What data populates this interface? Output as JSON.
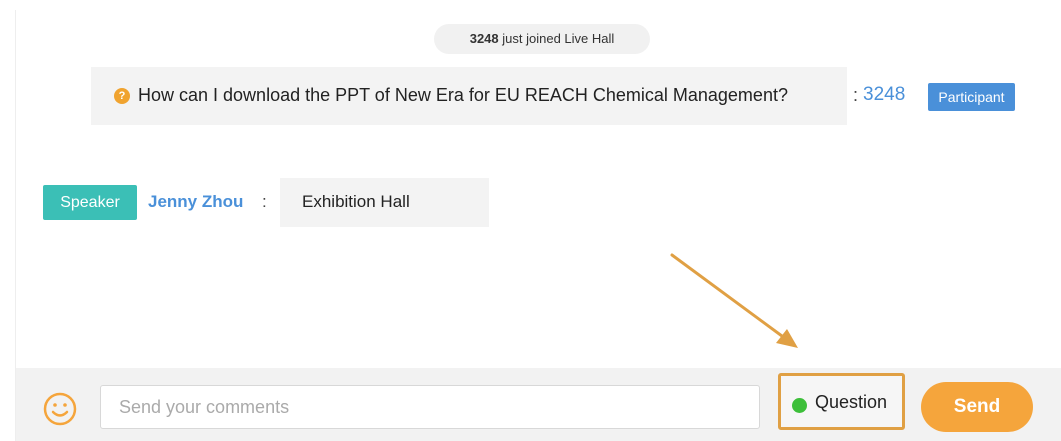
{
  "chat": {
    "join_notice": {
      "user_number": "3248",
      "text": "just joined Live Hall"
    },
    "question_message": {
      "icon": "question-circle-icon",
      "text": "How can I download the PPT of New Era for EU REACH Chemical Management?",
      "separator": ":",
      "user": "3248",
      "role_badge": "Participant"
    },
    "speaker_message": {
      "role_badge": "Speaker",
      "name": "Jenny Zhou",
      "separator": ":",
      "text": "Exhibition Hall"
    }
  },
  "composer": {
    "emoji_icon": "smiley-face-icon",
    "input_placeholder": "Send your comments",
    "input_value": "",
    "question_toggle_label": "Question",
    "question_toggle_active": true,
    "send_label": "Send"
  },
  "colors": {
    "accent_orange": "#f5a53c",
    "participant_blue": "#4a90d9",
    "speaker_teal": "#3bbfb6",
    "active_green": "#3dbf3a",
    "annotation_orange": "#e0a044"
  }
}
